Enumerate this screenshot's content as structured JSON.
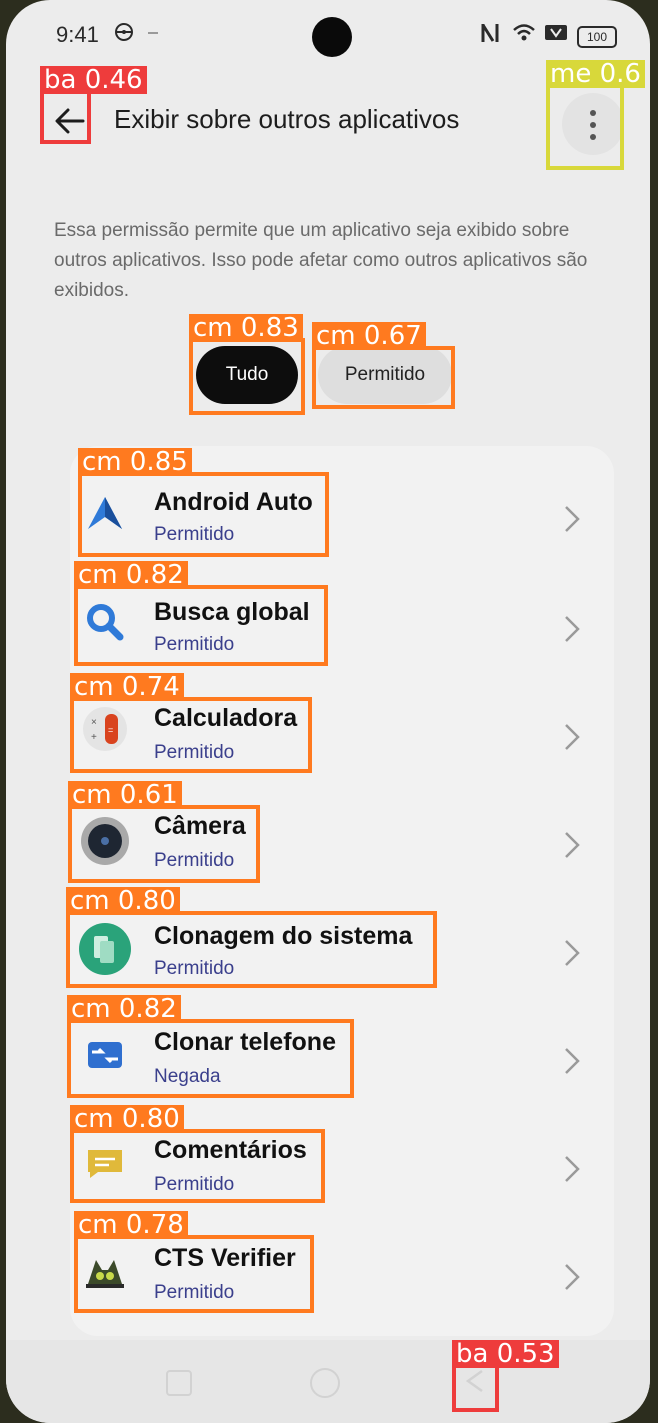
{
  "status_bar": {
    "time": "9:41",
    "battery": "100"
  },
  "header": {
    "title": "Exibir sobre outros aplicativos",
    "back_icon": "arrow-left-icon",
    "menu_icon": "more-vertical-icon"
  },
  "description": "Essa permissão permite que um aplicativo seja exibido sobre outros aplicativos. Isso pode afetar como outros aplicativos são exibidos.",
  "filters": {
    "all": "Tudo",
    "allowed": "Permitido",
    "active": "all"
  },
  "apps": [
    {
      "name": "Android Auto",
      "status": "Permitido",
      "icon": "android-auto-icon"
    },
    {
      "name": "Busca global",
      "status": "Permitido",
      "icon": "search-icon"
    },
    {
      "name": "Calculadora",
      "status": "Permitido",
      "icon": "calculator-icon"
    },
    {
      "name": "Câmera",
      "status": "Permitido",
      "icon": "camera-icon"
    },
    {
      "name": "Clonagem do sistema",
      "status": "Permitido",
      "icon": "system-clone-icon"
    },
    {
      "name": "Clonar telefone",
      "status": "Negada",
      "icon": "phone-clone-icon"
    },
    {
      "name": "Comentários",
      "status": "Permitido",
      "icon": "feedback-icon"
    },
    {
      "name": "CTS Verifier",
      "status": "Permitido",
      "icon": "cts-verifier-icon"
    }
  ],
  "detections": [
    {
      "label": "ba 0.46"
    },
    {
      "label": "me 0.6"
    },
    {
      "label": "cm 0.83"
    },
    {
      "label": "cm 0.67"
    },
    {
      "label": "cm 0.85"
    },
    {
      "label": "cm 0.82"
    },
    {
      "label": "cm 0.74"
    },
    {
      "label": "cm 0.61"
    },
    {
      "label": "cm 0.80"
    },
    {
      "label": "cm 0.82"
    },
    {
      "label": "cm 0.80"
    },
    {
      "label": "cm 0.78"
    },
    {
      "label": "ba 0.53"
    }
  ]
}
